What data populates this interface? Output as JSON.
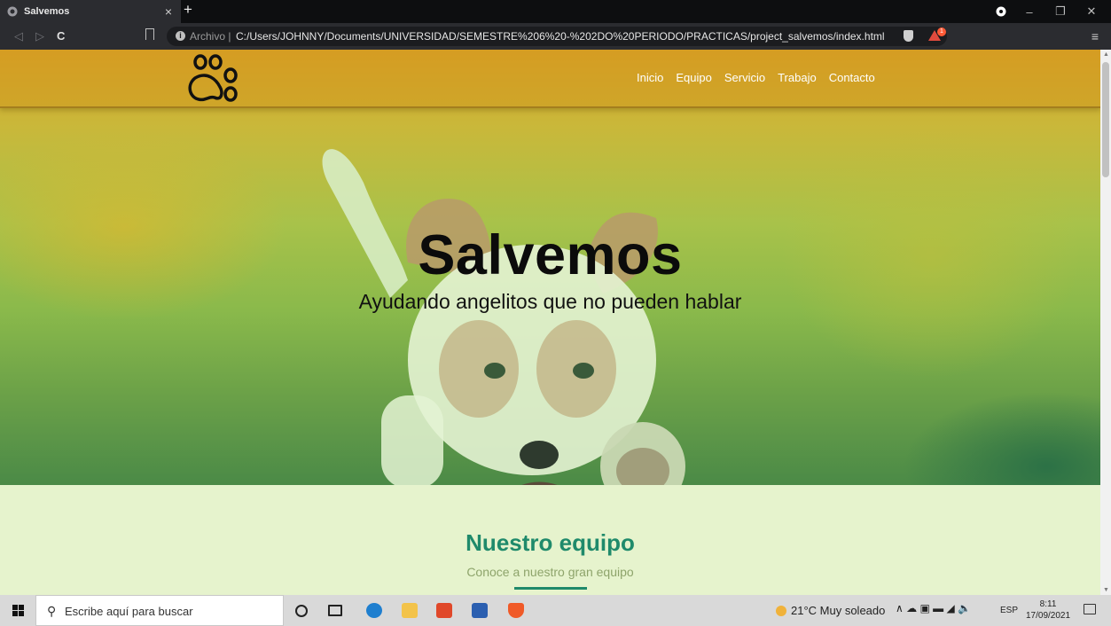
{
  "browser": {
    "tab_title": "Salvemos",
    "tab_close": "×",
    "new_tab": "+",
    "scheme_label": "Archivo",
    "url": "C:/Users/JOHNNY/Documents/UNIVERSIDAD/SEMESTRE%206%20-%202DO%20PERIODO/PRACTICAS/project_salvemos/index.html",
    "notification_count": "1",
    "menu_glyph": "≡",
    "minimize_glyph": "–",
    "restore_glyph": "❐",
    "close_glyph": "✕"
  },
  "site": {
    "nav": [
      "Inicio",
      "Equipo",
      "Servicio",
      "Trabajo",
      "Contacto"
    ],
    "hero_title": "Salvemos",
    "hero_subtitle": "Ayudando angelitos que no pueden hablar",
    "team_title": "Nuestro equipo",
    "team_subtitle": "Conoce a nuestro gran equipo",
    "colors": {
      "accent": "#1f8a6b",
      "section_bg": "#e6f3cd",
      "hero_overlay": "#9fcf6a"
    }
  },
  "taskbar": {
    "search_placeholder": "Escribe aquí para buscar",
    "weather": "21°C  Muy soleado",
    "tray_glyphs": "∧ ☁ ▣ ▬ ◢ 🔈",
    "language": "ESP",
    "time": "8:11",
    "date": "17/09/2021"
  },
  "icons": [
    "brave-icon",
    "paw-logo-icon",
    "windows-icon",
    "search-icon",
    "task-view-icon",
    "edge-icon",
    "file-explorer-icon",
    "office-icon",
    "word-icon",
    "brave-taskbar-icon",
    "notification-icon"
  ]
}
